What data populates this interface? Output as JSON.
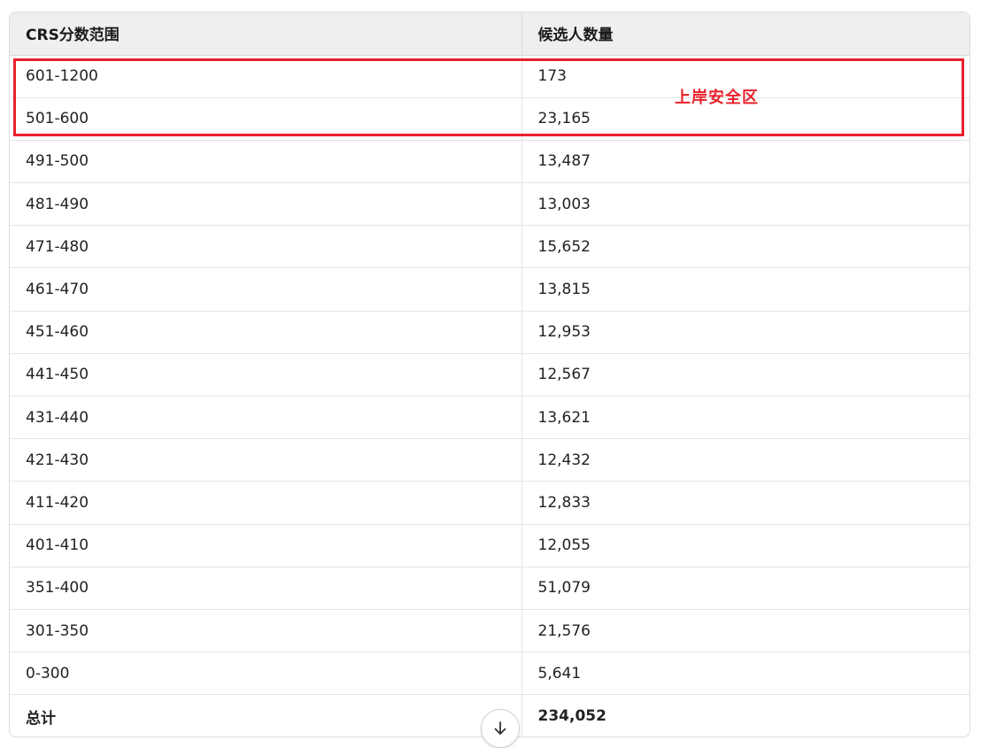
{
  "table": {
    "headers": [
      "CRS分数范围",
      "候选人数量"
    ],
    "rows": [
      [
        "601-1200",
        "173"
      ],
      [
        "501-600",
        "23,165"
      ],
      [
        "491-500",
        "13,487"
      ],
      [
        "481-490",
        "13,003"
      ],
      [
        "471-480",
        "15,652"
      ],
      [
        "461-470",
        "13,815"
      ],
      [
        "451-460",
        "12,953"
      ],
      [
        "441-450",
        "12,567"
      ],
      [
        "431-440",
        "13,621"
      ],
      [
        "421-430",
        "12,432"
      ],
      [
        "411-420",
        "12,833"
      ],
      [
        "401-410",
        "12,055"
      ],
      [
        "351-400",
        "51,079"
      ],
      [
        "301-350",
        "21,576"
      ],
      [
        "0-300",
        "5,641"
      ],
      [
        "总计",
        "234,052"
      ]
    ]
  },
  "annotation": {
    "label": "上岸安全区",
    "color": "#e8202a"
  },
  "scroll_button": {
    "icon": "arrow-down-icon"
  }
}
